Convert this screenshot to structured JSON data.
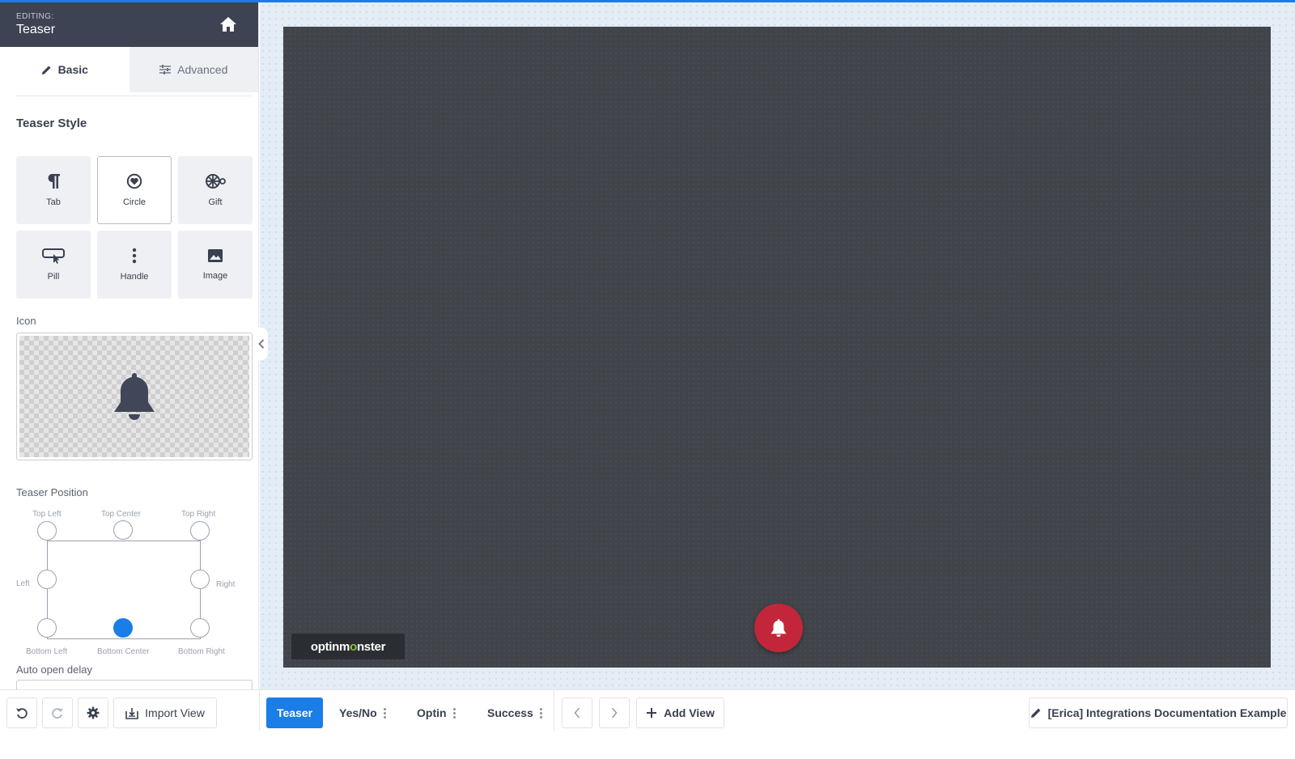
{
  "header": {
    "eyebrow": "EDITING:",
    "title": "Teaser"
  },
  "tabs": {
    "basic": "Basic",
    "advanced": "Advanced"
  },
  "teaser_style": {
    "title": "Teaser Style",
    "options": [
      "Tab",
      "Circle",
      "Gift",
      "Pill",
      "Handle",
      "Image"
    ],
    "selected": "Circle"
  },
  "icon": {
    "label": "Icon",
    "value": "bell-icon"
  },
  "position": {
    "label": "Teaser Position",
    "labels": {
      "top_left": "Top Left",
      "top_center": "Top Center",
      "top_right": "Top Right",
      "left": "Left",
      "right": "Right",
      "bottom_left": "Bottom Left",
      "bottom_center": "Bottom Center",
      "bottom_right": "Bottom Right"
    },
    "selected": "Bottom Center"
  },
  "auto_open": {
    "label": "Auto open delay"
  },
  "preview": {
    "brand_pre": "optinm",
    "brand_o": "o",
    "brand_post": "nster",
    "teaser_color": "#c3263a"
  },
  "bottombar": {
    "import_view": "Import View",
    "views": [
      "Teaser",
      "Yes/No",
      "Optin",
      "Success"
    ],
    "active_view": "Teaser",
    "add_view": "Add View",
    "campaign_name": "[Erica] Integrations Documentation Example"
  },
  "colors": {
    "accent": "#1a7de8",
    "header_bg": "#3d4352",
    "canvas_bg": "#41454a"
  }
}
